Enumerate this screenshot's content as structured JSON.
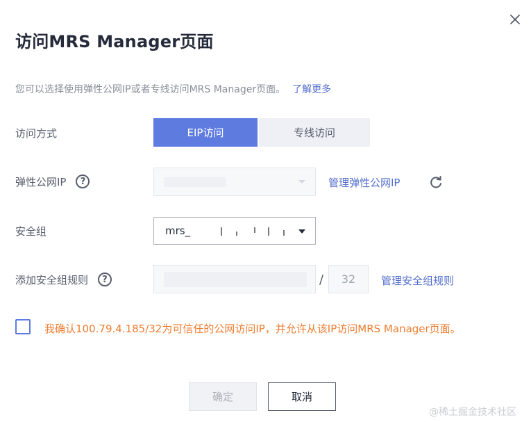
{
  "dialog": {
    "title": "访问MRS Manager页面",
    "description": "您可以选择使用弹性公网IP或者专线访问MRS Manager页面。",
    "learn_more": "了解更多"
  },
  "access_mode": {
    "label": "访问方式",
    "options": [
      "EIP访问",
      "专线访问"
    ],
    "selected": "EIP访问"
  },
  "eip": {
    "label": "弹性公网IP",
    "help": "?",
    "manage_link": "管理弹性公网IP"
  },
  "security_group": {
    "label": "安全组",
    "value": "mrs_"
  },
  "sg_rule": {
    "label": "添加安全组规则",
    "help": "?",
    "separator": "/",
    "mask": "32",
    "manage_link": "管理安全组规则"
  },
  "confirm": {
    "text": "我确认100.79.4.185/32为可信任的公网访问IP，并允许从该IP访问MRS Manager页面。"
  },
  "buttons": {
    "ok": "确定",
    "cancel": "取消"
  },
  "watermark": "@稀土掘金技术社区",
  "colors": {
    "primary": "#5e7ce0",
    "link": "#526ecc",
    "warning": "#ed7d31"
  },
  "icons": {
    "close": "close-icon",
    "help": "help-circle-icon",
    "refresh": "refresh-icon",
    "dropdown": "chevron-down-icon"
  }
}
